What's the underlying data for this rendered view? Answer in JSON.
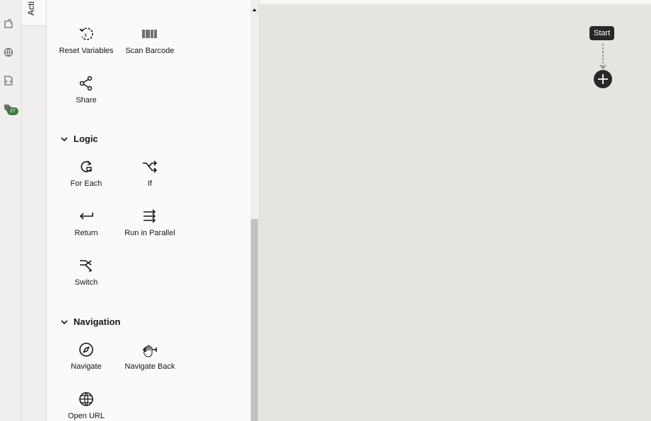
{
  "tabs": {
    "active_label": "Acti"
  },
  "rail": {
    "badge_count": "27"
  },
  "palette": {
    "items_top": [
      {
        "label": "Reset Variables",
        "icon": "reset-variables-icon"
      },
      {
        "label": "Scan Barcode",
        "icon": "barcode-icon"
      },
      {
        "label": "Share",
        "icon": "share-icon"
      }
    ],
    "logic": {
      "title": "Logic",
      "items": [
        {
          "label": "For Each",
          "icon": "for-each-icon"
        },
        {
          "label": "If",
          "icon": "if-icon"
        },
        {
          "label": "Return",
          "icon": "return-icon"
        },
        {
          "label": "Run in Parallel",
          "icon": "run-parallel-icon"
        },
        {
          "label": "Switch",
          "icon": "switch-icon"
        }
      ]
    },
    "navigation": {
      "title": "Navigation",
      "items": [
        {
          "label": "Navigate",
          "icon": "compass-icon"
        },
        {
          "label": "Navigate Back",
          "icon": "back-arrow-icon"
        },
        {
          "label": "Open URL",
          "icon": "globe-icon"
        }
      ]
    }
  },
  "canvas": {
    "start_label": "Start"
  }
}
